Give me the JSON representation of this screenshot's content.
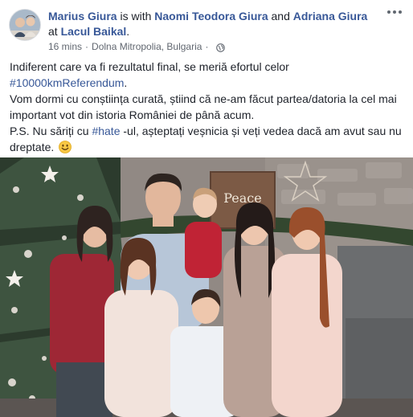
{
  "post": {
    "author": "Marius Giura",
    "with_text": "is with",
    "tagged_1": "Naomi Teodora Giura",
    "and_text": "and",
    "tagged_2": "Adriana Giura",
    "at_text": "at",
    "place": "Lacul Baikal",
    "period": ".",
    "time": "16 mins",
    "separator": "·",
    "location": "Dolna Mitropolia, Bulgaria",
    "separator_2": "·",
    "privacy_icon": "globe-icon",
    "more_icon": "more-options-icon"
  },
  "body": {
    "line1": "Indiferent care va fi rezultatul final, se meriă efortul celor",
    "hashtag1": "#10000kmReferendum",
    "hashtag1_end": ".",
    "line2": "Vom dormi cu conștiința curată, știind că ne-am făcut partea/datoria la cel mai important vot din istoria României de până acum.",
    "ps_start": "P.S. Nu săriți cu ",
    "hashtag2": "#hate",
    "ps_end": " -ul, așteptați veșnicia și veți vedea dacă am avut sau nu dreptate.",
    "emoji": "smiley-emoji"
  },
  "photo": {
    "sign_text": "Peace"
  },
  "colors": {
    "link": "#385898",
    "text": "#1d2129",
    "meta": "#616770"
  }
}
